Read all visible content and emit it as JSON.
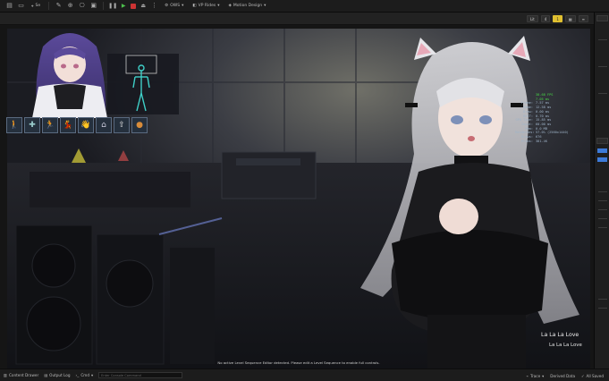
{
  "toolbar": {
    "mode_label": "Se",
    "platforms_label": "OWS",
    "vr_label": "VP Rides",
    "motion_label": "Motion Design"
  },
  "viewport_bar": {
    "chips": [
      "Lit",
      "4",
      "1"
    ]
  },
  "stats": [
    {
      "k": "",
      "v": "38.68 FPS",
      "green": true
    },
    {
      "k": "",
      "v": "7.05 ms",
      "green": true
    },
    {
      "k": "Frame:",
      "v": "7.57 ms",
      "green": false
    },
    {
      "k": "Game:",
      "v": "12.58 ms",
      "green": false
    },
    {
      "k": "Draw:",
      "v": "0.00 ms",
      "green": false
    },
    {
      "k": "RHIT:",
      "v": "0.70 ms",
      "green": false
    },
    {
      "k": "GPU Time:",
      "v": "15.85 ms",
      "green": false
    },
    {
      "k": "Input:",
      "v": "60.00 ms",
      "green": false
    },
    {
      "k": "Mem:",
      "v": "0.0 MB",
      "green": false
    },
    {
      "k": "RenderRes:",
      "v": "57.0% (2560x1440)",
      "green": false
    },
    {
      "k": "Draws:",
      "v": "676",
      "green": false
    },
    {
      "k": "Prims:",
      "v": "381.4K",
      "green": false
    }
  ],
  "overlay": {
    "song_title": "La La La Love",
    "song_subtitle": "La La La Love",
    "notice": "No active Level Sequence Editor detected. Please edit a Level Sequence to enable full controls."
  },
  "bottom_bar": {
    "content_drawer": "Content Drawer",
    "output_log": "Output Log",
    "cmd_label": "Cmd",
    "cmd_placeholder": "Enter Console Command",
    "trace_label": "Trace",
    "derived_label": "Derived Data",
    "all_saved": "All Saved",
    "revision_label": "Revision Control"
  },
  "colors": {
    "accent_yellow": "#e0c030",
    "stat_green": "#46d646",
    "selection_blue": "#3d7bd9"
  }
}
